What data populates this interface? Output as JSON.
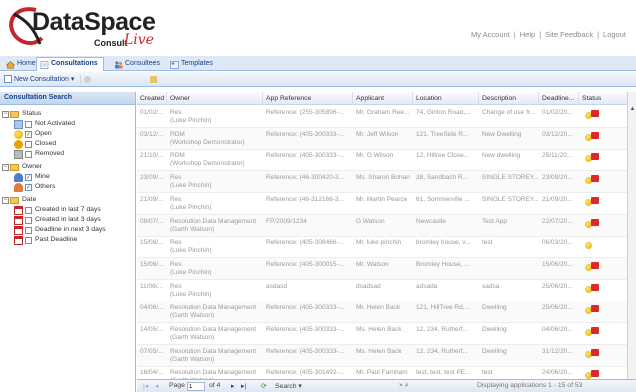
{
  "header": {
    "brand": "DataSpace",
    "consult": "Consult",
    "live": "Live",
    "links": [
      "My Account",
      "Help",
      "Site Feedback",
      "Logout"
    ],
    "separator": "|"
  },
  "tabs": [
    {
      "label": "Home",
      "icon": "home-icon"
    },
    {
      "label": "Consultations",
      "icon": "document-icon"
    },
    {
      "label": "Consultees",
      "icon": "people-icon"
    },
    {
      "label": "Templates",
      "icon": "template-icon"
    }
  ],
  "toolbar": {
    "new_consultation": "New Consultation"
  },
  "left_panel": {
    "title": "Consultation Search",
    "status": {
      "label": "Status",
      "items": [
        "Not Activated",
        "Open",
        "Closed",
        "Removed"
      ]
    },
    "owner": {
      "label": "Owner",
      "items": [
        "Mine",
        "Others"
      ]
    },
    "date": {
      "label": "Date",
      "items": [
        "Created in last 7 days",
        "Created in last 3 days",
        "Deadline in next 3 days",
        "Past Deadline"
      ]
    }
  },
  "grid": {
    "columns": [
      "Created",
      "Owner",
      "App Reference",
      "Applicant",
      "Location",
      "Description",
      "Deadline...",
      "Status"
    ],
    "rows": [
      {
        "created": "01/02/...",
        "owner": "Res",
        "owner_sub": "(Luke Pinchin)",
        "ref": "Reference: (255-305896-...",
        "applicant": "Mr. Graham Ree...",
        "location": "74, Ginton Road,...",
        "description": "Change of use fr...",
        "deadline": "01/02/20...",
        "status": "icons"
      },
      {
        "created": "03/12/...",
        "owner": "RDM",
        "owner_sub": "(Workshop Demonstrator)",
        "ref": "Reference: (405-300333-...",
        "applicant": "Mr. Jeff Wilson",
        "location": "121, TreeSide R...",
        "description": "New Dwelling",
        "deadline": "03/12/20...",
        "status": "icons"
      },
      {
        "created": "21/10/...",
        "owner": "RDM",
        "owner_sub": "(Workshop Demonstrator)",
        "ref": "Reference: (405-300333-...",
        "applicant": "Mr. G Wilson",
        "location": "12, Hillree Close...",
        "description": "New dwelling",
        "deadline": "25/11/20...",
        "status": "icons"
      },
      {
        "created": "23/09/...",
        "owner": "Res",
        "owner_sub": "(Luke Pinchin)",
        "ref": "Reference: (46-300420-3...",
        "applicant": "Ms. Sharon Bohan",
        "location": "38, Sandbach R...",
        "description": "SINGLE STOREY...",
        "deadline": "23/09/20...",
        "status": "icons"
      },
      {
        "created": "21/09/...",
        "owner": "Res",
        "owner_sub": "(Luke Pinchin)",
        "ref": "Reference: (46-312166-3...",
        "applicant": "Mr. Martin Pearce",
        "location": "61, Sommerville ...",
        "description": "SINGLE STOREY...",
        "deadline": "21/09/20...",
        "status": "icons"
      },
      {
        "created": "08/07/...",
        "owner": "Resolution Data Management",
        "owner_sub": "(Garth Watson)",
        "ref": "FP/2009/1234",
        "applicant": "G Watson",
        "location": "Newcastle",
        "description": "Test App",
        "deadline": "22/07/20...",
        "status": "icons"
      },
      {
        "created": "15/06/...",
        "owner": "Res",
        "owner_sub": "(Luke Pinchin)",
        "ref": "Reference: (405-308466-...",
        "applicant": "Mr. luke pinchin",
        "location": "bromley house, v...",
        "description": "test",
        "deadline": "06/03/20...",
        "status": "sun"
      },
      {
        "created": "15/06/...",
        "owner": "Res",
        "owner_sub": "(Luke Pinchin)",
        "ref": "Reference: (405-300015-...",
        "applicant": "Mr. Watson",
        "location": "Bromley House, ...",
        "description": "",
        "deadline": "15/06/20...",
        "status": "icons"
      },
      {
        "created": "11/06/...",
        "owner": "Res",
        "owner_sub": "(Luke Pinchin)",
        "ref": "asdasd",
        "applicant": "dsadsad",
        "location": "adsada",
        "description": "sadsa",
        "deadline": "25/06/20...",
        "status": "icons"
      },
      {
        "created": "04/06/...",
        "owner": "Resolution Data Management",
        "owner_sub": "(Garth Watson)",
        "ref": "Reference: (405-300333-...",
        "applicant": "Mr. Helen Back",
        "location": "121, HillTree Rd,...",
        "description": "Dwelling",
        "deadline": "25/06/20...",
        "status": "icons"
      },
      {
        "created": "14/05/...",
        "owner": "Resolution Data Management",
        "owner_sub": "(Garth Watson)",
        "ref": "Reference: (405-300333-...",
        "applicant": "Ms. Helen Back",
        "location": "12, 234, Rutherf...",
        "description": "Dwelling",
        "deadline": "04/06/20...",
        "status": "icons"
      },
      {
        "created": "07/05/...",
        "owner": "Resolution Data Management",
        "owner_sub": "(Garth Watson)",
        "ref": "Reference: (405-300333-...",
        "applicant": "Ms. Helen Back",
        "location": "12, 234, Rutherf...",
        "description": "Dwelling",
        "deadline": "31/12/20...",
        "status": "icons"
      },
      {
        "created": "16/04/...",
        "owner": "Resolution Data Management",
        "owner_sub": "(Garth Watson)",
        "ref": "Reference: (405-301492-...",
        "applicant": "Mr. Paul Farnham",
        "location": "test, test, test PE...",
        "description": "test",
        "deadline": "24/06/20...",
        "status": "icons"
      }
    ]
  },
  "pager": {
    "page_label": "Page",
    "page_value": "1",
    "of_label": "of 4",
    "search_label": "Search",
    "displaying": "Displaying applications 1 - 15 of 53"
  },
  "colors": {
    "accent": "#15428b",
    "border": "#99bbe8",
    "live_red": "#c1272d"
  }
}
